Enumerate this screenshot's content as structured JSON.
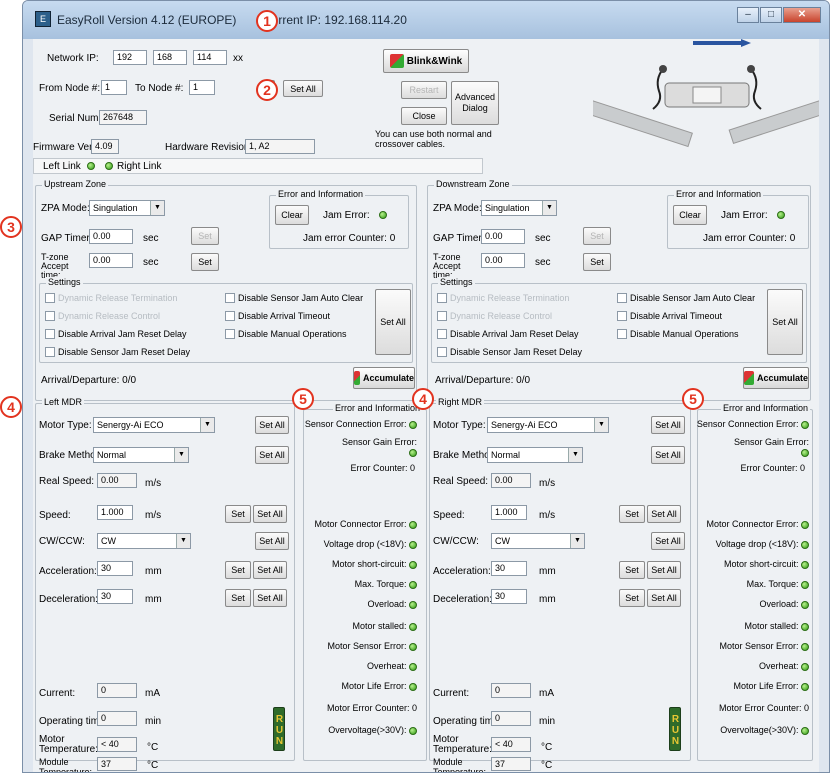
{
  "window": {
    "title": "EasyRoll Version 4.12 (EUROPE)",
    "current_ip": "Current IP: 192.168.114.20",
    "controls": {
      "minimize": "–",
      "maximize": "□",
      "close": "✕"
    }
  },
  "header": {
    "network_ip_label": "Network IP:",
    "ip": [
      "192",
      "168",
      "114"
    ],
    "ip_suffix": "xx",
    "from_node_label": "From Node #:",
    "from_node": "1",
    "to_node_label": "To Node #:",
    "to_node": "1",
    "stepper_label": "+",
    "set_all": "Set All",
    "serial_label": "Serial Number:",
    "serial": "267648",
    "firmware_label": "Firmware Version:",
    "firmware": "4.09",
    "hardware_label": "Hardware Revision:",
    "hardware": "1, A2",
    "blink_label": "Blink&Wink",
    "restart_label": "Restart",
    "close_label": "Close",
    "advanced_label": "Advanced Dialog",
    "cable_note": "You can use both normal and crossover cables.",
    "left_link": "Left Link",
    "right_link": "Right Link"
  },
  "callouts": [
    "1",
    "2",
    "3",
    "4",
    "5",
    "5",
    "4"
  ],
  "upstream": {
    "zone_title": "Upstream Zone",
    "zpa_label": "ZPA Mode:",
    "zpa_value": "Singulation",
    "gap_label": "GAP Timer:",
    "gap_value": "0.00",
    "gap_unit": "sec",
    "gap_set": "Set",
    "tzone_label": "T-zone Accept time:",
    "tzone_value": "0.00",
    "tzone_unit": "sec",
    "tzone_set": "Set",
    "error_title": "Error and Information",
    "clear_label": "Clear",
    "jam_error_label": "Jam Error:",
    "jam_counter": "Jam error Counter: 0",
    "settings_title": "Settings",
    "settings": [
      {
        "label": "Dynamic Release Termination",
        "disabled": true
      },
      {
        "label": "Dynamic Release Control",
        "disabled": true
      },
      {
        "label": "Disable Arrival Jam Reset Delay",
        "disabled": false
      },
      {
        "label": "Disable Sensor Jam Reset Delay",
        "disabled": false
      },
      {
        "label": "Disable Sensor Jam Auto Clear",
        "disabled": false
      },
      {
        "label": "Disable Arrival Timeout",
        "disabled": false
      },
      {
        "label": "Disable Manual Operations",
        "disabled": false
      }
    ],
    "settings_set_all": "Set All",
    "arrival": "Arrival/Departure: 0/0",
    "accumulate_label": "Accumulate"
  },
  "downstream": {
    "zone_title": "Downstream Zone",
    "zpa_label": "ZPA Mode:",
    "zpa_value": "Singulation",
    "gap_label": "GAP Timer:",
    "gap_value": "0.00",
    "gap_unit": "sec",
    "gap_set": "Set",
    "tzone_label": "T-zone Accept time:",
    "tzone_value": "0.00",
    "tzone_unit": "sec",
    "tzone_set": "Set",
    "error_title": "Error and Information",
    "clear_label": "Clear",
    "jam_error_label": "Jam Error:",
    "jam_counter": "Jam error Counter: 0",
    "settings_title": "Settings",
    "settings": [
      {
        "label": "Dynamic Release Termination",
        "disabled": true
      },
      {
        "label": "Dynamic Release Control",
        "disabled": true
      },
      {
        "label": "Disable Arrival Jam Reset Delay",
        "disabled": false
      },
      {
        "label": "Disable Sensor Jam Reset Delay",
        "disabled": false
      },
      {
        "label": "Disable Sensor Jam Auto Clear",
        "disabled": false
      },
      {
        "label": "Disable Arrival Timeout",
        "disabled": false
      },
      {
        "label": "Disable Manual Operations",
        "disabled": false
      }
    ],
    "settings_set_all": "Set All",
    "arrival": "Arrival/Departure: 0/0",
    "accumulate_label": "Accumulate"
  },
  "left_mdr": {
    "title": "Left MDR",
    "motor_type_label": "Motor Type:",
    "motor_type": "Senergy-Ai ECO",
    "brake_label": "Brake Method:",
    "brake": "Normal",
    "real_speed_label": "Real Speed:",
    "real_speed": "0.00",
    "real_speed_unit": "m/s",
    "speed_label": "Speed:",
    "speed": "1.000",
    "speed_unit": "m/s",
    "cw_label": "CW/CCW:",
    "cw": "CW",
    "accel_label": "Acceleration:",
    "accel": "30",
    "accel_unit": "mm",
    "decel_label": "Deceleration:",
    "decel": "30",
    "decel_unit": "mm",
    "current_label": "Current:",
    "current": "0",
    "current_unit": "mA",
    "optime_label": "Operating time:",
    "optime": "0",
    "optime_unit": "min",
    "motor_temp_label": "Motor Temperature:",
    "motor_temp": "< 40",
    "motor_temp_unit": "°C",
    "module_temp_label": "Module Temperature:",
    "module_temp": "37",
    "module_temp_unit": "°C",
    "set": "Set",
    "set_all": "Set All",
    "run_label": "RUN",
    "err": {
      "title": "Error and Information",
      "sensor_conn": "Sensor Connection Error:",
      "sensor_gain": "Sensor Gain Error:",
      "error_counter": "Error Counter: 0",
      "motor_conn": "Motor Connector Error:",
      "voltage_drop": "Voltage drop (<18V):",
      "short_circuit": "Motor short-circuit:",
      "max_torque": "Max. Torque:",
      "overload": "Overload:",
      "stalled": "Motor stalled:",
      "motor_sensor": "Motor Sensor Error:",
      "overheat": "Overheat:",
      "life_error": "Motor Life Error:",
      "motor_err_counter": "Motor Error Counter: 0",
      "overvoltage": "Overvoltage(>30V):"
    }
  },
  "right_mdr": {
    "title": "Right MDR",
    "motor_type_label": "Motor Type:",
    "motor_type": "Senergy-Ai ECO",
    "brake_label": "Brake Method:",
    "brake": "Normal",
    "real_speed_label": "Real Speed:",
    "real_speed": "0.00",
    "real_speed_unit": "m/s",
    "speed_label": "Speed:",
    "speed": "1.000",
    "speed_unit": "m/s",
    "cw_label": "CW/CCW:",
    "cw": "CW",
    "accel_label": "Acceleration:",
    "accel": "30",
    "accel_unit": "mm",
    "decel_label": "Deceleration:",
    "decel": "30",
    "decel_unit": "mm",
    "current_label": "Current:",
    "current": "0",
    "current_unit": "mA",
    "optime_label": "Operating time:",
    "optime": "0",
    "optime_unit": "min",
    "motor_temp_label": "Motor Temperature:",
    "motor_temp": "< 40",
    "motor_temp_unit": "°C",
    "module_temp_label": "Module Temperature:",
    "module_temp": "37",
    "module_temp_unit": "°C",
    "set": "Set",
    "set_all": "Set All",
    "run_label": "RUN",
    "err": {
      "title": "Error and Information",
      "sensor_conn": "Sensor Connection Error:",
      "sensor_gain": "Sensor Gain Error:",
      "error_counter": "Error Counter: 0",
      "motor_conn": "Motor Connector Error:",
      "voltage_drop": "Voltage drop (<18V):",
      "short_circuit": "Motor short-circuit:",
      "max_torque": "Max. Torque:",
      "overload": "Overload:",
      "stalled": "Motor stalled:",
      "motor_sensor": "Motor Sensor Error:",
      "overheat": "Overheat:",
      "life_error": "Motor Life Error:",
      "motor_err_counter": "Motor Error Counter: 0",
      "overvoltage": "Overvoltage(>30V):"
    }
  },
  "colors": {
    "led_ok": "#2f9a14",
    "callout": "#e2331f",
    "titlebar": "#a7c1de"
  }
}
